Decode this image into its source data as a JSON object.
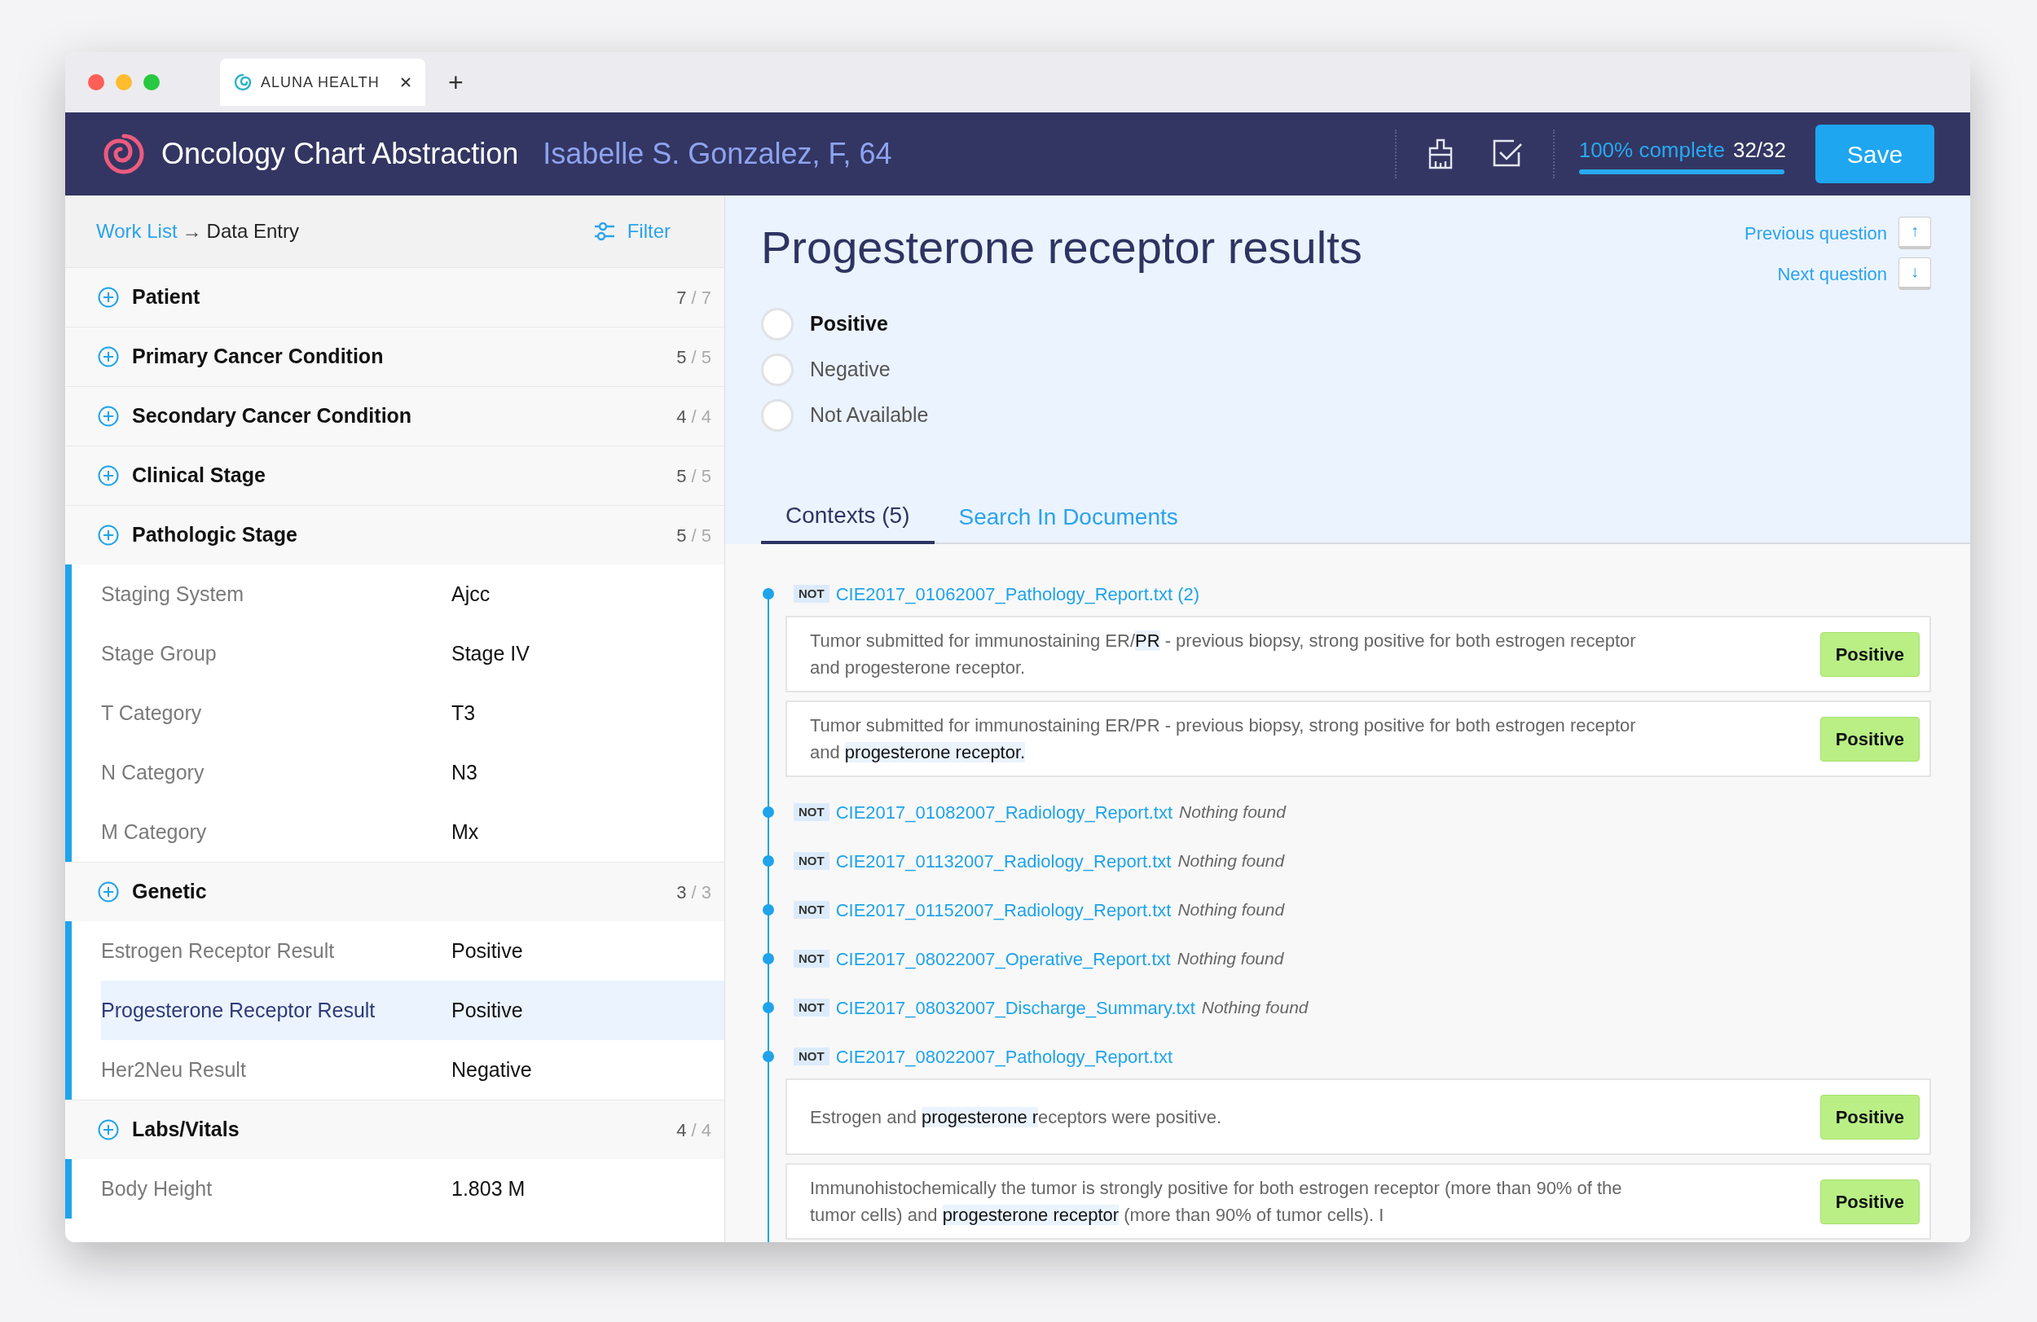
{
  "browser": {
    "tabs": [
      {
        "label": "ALUNA HEALTH",
        "selected": true
      }
    ],
    "new_tab": "+"
  },
  "header": {
    "title": "Oncology Chart Abstraction",
    "patient": "Isabelle S. Gonzalez, F, 64",
    "progress": {
      "label": "100% complete",
      "count": "32/32",
      "level": 1
    },
    "save": "Save"
  },
  "sidebar": {
    "breadcrumb": {
      "link": "Work List",
      "arrow": "→",
      "current": "Data Entry"
    },
    "filter": "Filter",
    "sections": [
      {
        "name": "Patient",
        "done": "7",
        "total": "/ 7"
      },
      {
        "name": "Primary Cancer Condition",
        "done": "5",
        "total": "/ 5"
      },
      {
        "name": "Secondary Cancer Condition",
        "done": "4",
        "total": "/ 4"
      },
      {
        "name": "Clinical Stage",
        "done": "5",
        "total": "/ 5"
      },
      {
        "name": "Pathologic Stage",
        "done": "5",
        "total": "/ 5",
        "fields": [
          {
            "label": "Staging System",
            "value": "Ajcc",
            "selected": false
          },
          {
            "label": "Stage Group",
            "value": "Stage IV",
            "selected": false
          },
          {
            "label": "T Category",
            "value": "T3",
            "selected": false
          },
          {
            "label": "N Category",
            "value": "N3",
            "selected": false
          },
          {
            "label": "M Category",
            "value": "Mx",
            "selected": false
          }
        ]
      },
      {
        "name": "Genetic",
        "done": "3",
        "total": "/ 3",
        "fields": [
          {
            "label": "Estrogen Receptor Result",
            "value": "Positive",
            "selected": false
          },
          {
            "label": "Progesterone Receptor Result",
            "value": "Positive",
            "selected": true
          },
          {
            "label": "Her2Neu Result",
            "value": "Negative",
            "selected": false
          }
        ]
      },
      {
        "name": "Labs/Vitals",
        "done": "4",
        "total": "/ 4",
        "fields": [
          {
            "label": "Body Height",
            "value": "1.803 M",
            "selected": false
          }
        ]
      }
    ]
  },
  "question": {
    "title": "Progesterone receptor results",
    "previous": "Previous question",
    "previous_key": "↑",
    "next": "Next question",
    "next_key": "↓",
    "options": [
      {
        "label": "Positive",
        "selected": true
      },
      {
        "label": "Negative",
        "selected": false
      },
      {
        "label": "Not Available",
        "selected": false
      }
    ],
    "tabs": [
      {
        "label": "Contexts (5)",
        "selected": true
      },
      {
        "label": "Search In Documents",
        "selected": false
      }
    ]
  },
  "contexts": [
    {
      "tag": "NOT",
      "file": "CIE2017_01062007_Pathology_Report.txt (2)",
      "snippets": [
        {
          "parts": [
            {
              "text": "Tumor submitted for immunostaining ER/",
              "highlight": false
            },
            {
              "text": "PR",
              "highlight": true
            },
            {
              "text": " - previous biopsy, strong positive for both estrogen receptor and progesterone receptor.",
              "highlight": false
            }
          ],
          "label": "Positive"
        },
        {
          "parts": [
            {
              "text": "Tumor submitted for immunostaining ER/PR - previous biopsy, strong positive for both estrogen receptor and ",
              "highlight": false
            },
            {
              "text": "progesterone receptor.",
              "highlight": true
            }
          ],
          "label": "Positive"
        }
      ]
    },
    {
      "tag": "NOT",
      "file": "CIE2017_01082007_Radiology_Report.txt",
      "note": "Nothing found"
    },
    {
      "tag": "NOT",
      "file": "CIE2017_01132007_Radiology_Report.txt",
      "note": "Nothing found"
    },
    {
      "tag": "NOT",
      "file": "CIE2017_01152007_Radiology_Report.txt",
      "note": "Nothing found"
    },
    {
      "tag": "NOT",
      "file": "CIE2017_08022007_Operative_Report.txt",
      "note": "Nothing found"
    },
    {
      "tag": "NOT",
      "file": "CIE2017_08032007_Discharge_Summary.txt",
      "note": "Nothing found"
    },
    {
      "tag": "NOT",
      "file": "CIE2017_08022007_Pathology_Report.txt",
      "snippets": [
        {
          "parts": [
            {
              "text": "Estrogen and ",
              "highlight": false
            },
            {
              "text": "progesterone r",
              "highlight": true
            },
            {
              "text": "eceptors were positive.",
              "highlight": false
            }
          ],
          "label": "Positive"
        },
        {
          "parts": [
            {
              "text": "Immunohistochemically the tumor is strongly positive for both estrogen receptor (more than 90% of the tumor cells) and ",
              "highlight": false
            },
            {
              "text": "progesterone receptor",
              "highlight": true
            },
            {
              "text": " (more than 90% of tumor cells). I",
              "highlight": false
            }
          ],
          "label": "Positive"
        }
      ]
    }
  ]
}
